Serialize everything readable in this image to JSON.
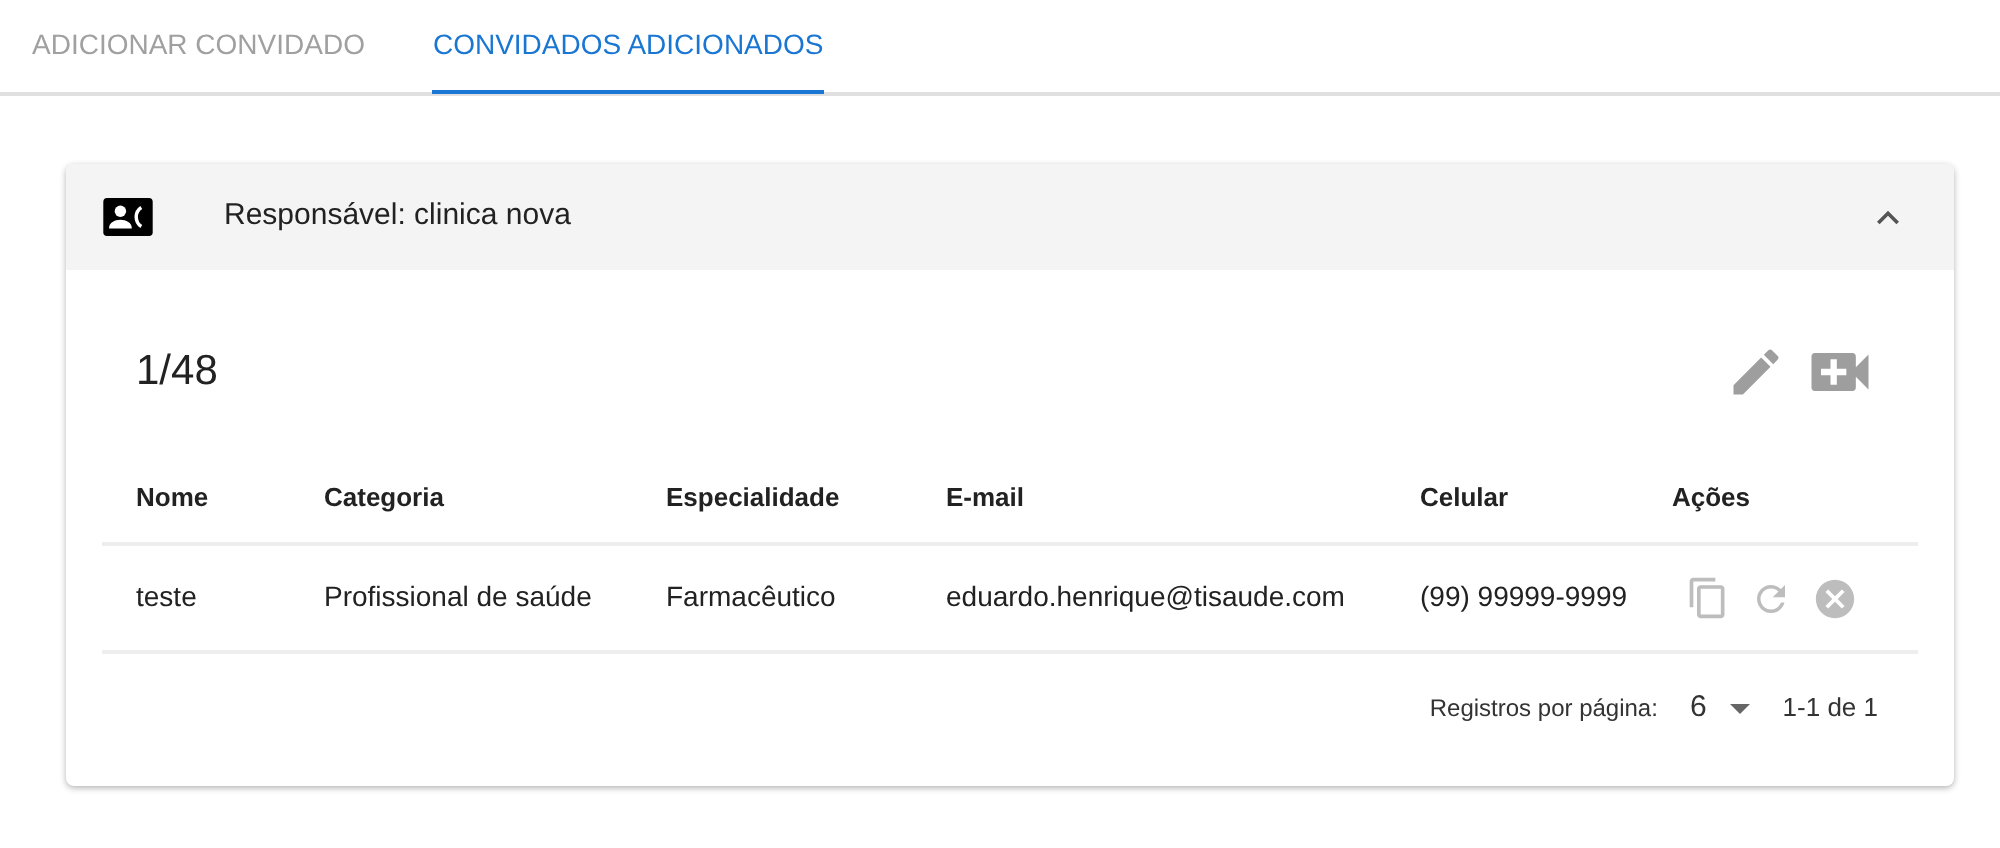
{
  "tabs": [
    {
      "label": "ADICIONAR CONVIDADO",
      "selected": false
    },
    {
      "label": "CONVIDADOS ADICIONADOS",
      "selected": true
    }
  ],
  "panel": {
    "title": "Responsável: clinica nova",
    "expanded": true
  },
  "counter": "1/48",
  "table": {
    "columns": [
      "Nome",
      "Categoria",
      "Especialidade",
      "E-mail",
      "Celular",
      "Ações"
    ],
    "rows": [
      {
        "cells": [
          "teste",
          "Profissional de saúde",
          "Farmacêutico",
          "eduardo.henrique@tisaude.com",
          "(99) 99999-9999"
        ]
      }
    ]
  },
  "pagination": {
    "rows_per_page_label": "Registros por página:",
    "rows_per_page": "6",
    "range": "1-1 de 1"
  }
}
